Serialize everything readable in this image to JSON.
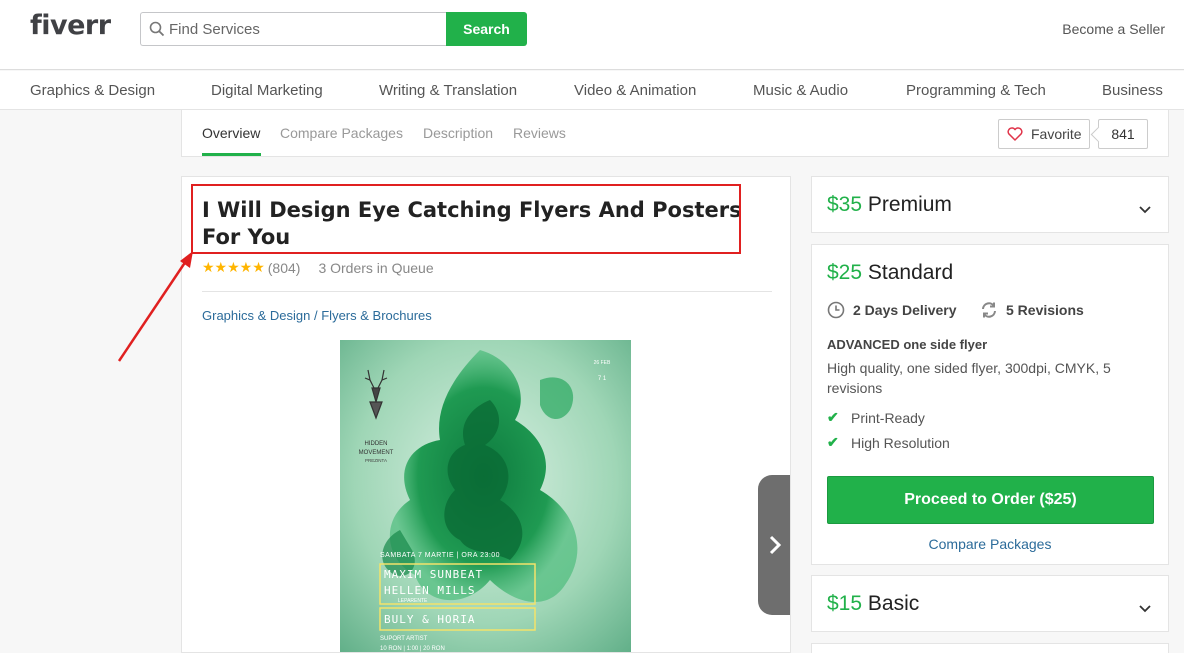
{
  "header": {
    "logo": "fiverr",
    "search_placeholder": "Find Services",
    "search_button": "Search",
    "become_seller": "Become a Seller"
  },
  "categories": [
    "Graphics & Design",
    "Digital Marketing",
    "Writing & Translation",
    "Video & Animation",
    "Music & Audio",
    "Programming & Tech",
    "Business"
  ],
  "subnav": {
    "tabs": [
      "Overview",
      "Compare Packages",
      "Description",
      "Reviews"
    ],
    "active_tab": "Overview",
    "favorite_label": "Favorite",
    "favorite_count": "841"
  },
  "gig": {
    "title": "I Will Design Eye Catching Flyers And Posters For You",
    "stars": "★★★★★",
    "rating_count": "(804)",
    "queue": "3 Orders in Queue",
    "breadcrumb_category": "Graphics & Design",
    "breadcrumb_separator": " / ",
    "breadcrumb_subcategory": "Flyers & Brochures"
  },
  "poster": {
    "brand_line1": "HIDDEN",
    "brand_line2": "MOVEMENT",
    "brand_line3": "PREZINTA",
    "date_line": "SAMBATA 7 MARTIE | ORA 23:00",
    "artist1": "MAXIM SUNBEAT",
    "artist2": "HELLEN MILLS",
    "artist2_sub": "LEPARENTE",
    "artist3": "BULY & HORIA",
    "footer1": "SUPORT ARTIST",
    "footer2": "10 RON | 1:00 | 20 RON",
    "corner_top": "26 FEB",
    "corner_mid": "7 1"
  },
  "packages": {
    "premium": {
      "price": "$35",
      "name": "Premium"
    },
    "standard": {
      "price": "$25",
      "name": "Standard",
      "delivery": "2 Days Delivery",
      "revisions": "5 Revisions",
      "title": "ADVANCED one side flyer",
      "description": "High quality, one sided flyer, 300dpi, CMYK, 5 revisions",
      "features": [
        "Print-Ready",
        "High Resolution"
      ],
      "order_button": "Proceed to Order ($25)",
      "compare_link": "Compare Packages"
    },
    "basic": {
      "price": "$15",
      "name": "Basic"
    }
  },
  "colors": {
    "brand_green": "#21b14a",
    "link_blue": "#2b6b9a",
    "star_yellow": "#ffb500",
    "annotation_red": "#e02020"
  }
}
